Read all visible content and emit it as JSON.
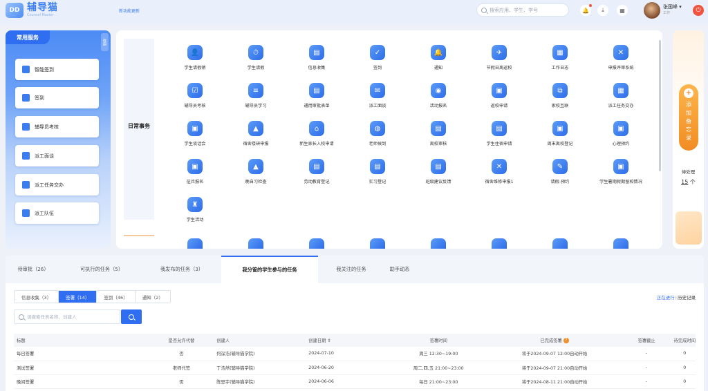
{
  "header": {
    "logo_mark": "DD",
    "app_title": "辅导猫",
    "app_subtitle": "Counsel Master",
    "version_link": "新功能更新",
    "search_placeholder": "搜索应用、学生、学号",
    "user_name": "张国峰",
    "user_role": "工作"
  },
  "quick_panel": {
    "title": "常用服务",
    "collapse": "收起",
    "items": [
      {
        "label": "智能签到",
        "icon": "smart-sign-icon"
      },
      {
        "label": "签到",
        "icon": "checkin-icon"
      },
      {
        "label": "辅导员考核",
        "icon": "assessment-icon"
      },
      {
        "label": "派工面谈",
        "icon": "interview-icon"
      },
      {
        "label": "派工任务交办",
        "icon": "task-assign-icon"
      },
      {
        "label": "派工队伍",
        "icon": "team-icon"
      }
    ]
  },
  "services": {
    "category": "日常事务",
    "items": [
      {
        "label": "学生请假销",
        "icon": "leave-icon",
        "glyph": "👤"
      },
      {
        "label": "学生请假",
        "icon": "clock-icon",
        "glyph": "⏱"
      },
      {
        "label": "信息收集",
        "icon": "collect-icon",
        "glyph": "▤"
      },
      {
        "label": "签到",
        "icon": "checkin-icon",
        "glyph": "✓"
      },
      {
        "label": "通知",
        "icon": "bell-icon",
        "glyph": "🔔"
      },
      {
        "label": "节假日离返校",
        "icon": "travel-icon",
        "glyph": "✈"
      },
      {
        "label": "工作日志",
        "icon": "log-icon",
        "glyph": "▦"
      },
      {
        "label": "申报评审系统",
        "icon": "tools-icon",
        "glyph": "✕"
      },
      {
        "label": "辅导员考核",
        "icon": "assess-icon",
        "glyph": "☑"
      },
      {
        "label": "辅导员学习",
        "icon": "study-icon",
        "glyph": "≡"
      },
      {
        "label": "通用审批表单",
        "icon": "form-icon",
        "glyph": "▤"
      },
      {
        "label": "派工面谈",
        "icon": "talk-icon",
        "glyph": "✉"
      },
      {
        "label": "活动报名",
        "icon": "activity-icon",
        "glyph": "◉"
      },
      {
        "label": "返校申请",
        "icon": "return-icon",
        "glyph": "▣"
      },
      {
        "label": "家校互联",
        "icon": "homeschool-icon",
        "glyph": "⧉"
      },
      {
        "label": "派工任务交办",
        "icon": "assign-icon",
        "glyph": "▦"
      },
      {
        "label": "学生谈话会",
        "icon": "meeting-icon",
        "glyph": "▣"
      },
      {
        "label": "宿舍楼研申报",
        "icon": "dorm-icon",
        "glyph": "▲"
      },
      {
        "label": "新生家长入校申请",
        "icon": "parent-icon",
        "glyph": "⌂"
      },
      {
        "label": "老师候到",
        "icon": "teacher-icon",
        "glyph": "◍"
      },
      {
        "label": "离校审核",
        "icon": "leave-school-icon",
        "glyph": "▤"
      },
      {
        "label": "学生住宿申请",
        "icon": "dorm-apply-icon",
        "glyph": "▤"
      },
      {
        "label": "周末离校登记",
        "icon": "weekend-icon",
        "glyph": "▣"
      },
      {
        "label": "心理预约",
        "icon": "psych-icon",
        "glyph": "▣"
      },
      {
        "label": "征兵报名",
        "icon": "enlist-icon",
        "glyph": "▣"
      },
      {
        "label": "晚自习检查",
        "icon": "evening-study-icon",
        "glyph": "▲"
      },
      {
        "label": "劳动教育登记",
        "icon": "labor-icon",
        "glyph": "▤"
      },
      {
        "label": "实习登记",
        "icon": "intern-icon",
        "glyph": "▤"
      },
      {
        "label": "班级建议反馈",
        "icon": "feedback-icon",
        "glyph": "▤"
      },
      {
        "label": "宿舍维修申报1",
        "icon": "repair-icon",
        "glyph": "✕"
      },
      {
        "label": "请假-预约",
        "icon": "reserve-icon",
        "glyph": "✎"
      },
      {
        "label": "学生暑期假期留校情况",
        "icon": "summer-icon",
        "glyph": "▣"
      },
      {
        "label": "学生活动",
        "icon": "student-activity-icon",
        "glyph": "♜"
      }
    ]
  },
  "side_panel": {
    "add_button": "添加备忘录",
    "todo_label": "待处理",
    "todo_count": "15",
    "todo_unit": "个"
  },
  "tabs": [
    {
      "label": "待审批（26）"
    },
    {
      "label": "可执行的任务（5）"
    },
    {
      "label": "我发布的任务（3）"
    },
    {
      "label": "我分管的学生参与的任务",
      "active": true
    },
    {
      "label": "我关注的任务"
    },
    {
      "label": "助手动态"
    }
  ],
  "subtabs": [
    {
      "label": "信息收集（3）"
    },
    {
      "label": "签署（14）",
      "active": true
    },
    {
      "label": "签到（46）"
    },
    {
      "label": "通知（2）"
    }
  ],
  "links": {
    "running": "正在进行",
    "history": "历史记录"
  },
  "task_search_placeholder": "请搜索任务名称、创建人",
  "table": {
    "headers": [
      "标题",
      "是否允许代替",
      "创建人",
      "创建日期 ⇕",
      "签署时间",
      "已完成签署",
      "签署截止",
      "待完成时间"
    ],
    "rows": [
      [
        "每日签署",
        "否",
        "何深浩(辅导猫学院)",
        "2024-07-10",
        "周三 12:30~19:00",
        "将于2024-09-07 12:00自动开始",
        "-",
        "0"
      ],
      [
        "测试签署",
        "老师代签",
        "丁浩然(辅导猫学院)",
        "2024-06-20",
        "周二,四,五 21:00~23:00",
        "将于2024-09-07 21:00自动开始",
        "-",
        "0"
      ],
      [
        "晚间签署",
        "否",
        "陈思宇(辅导猫学院)",
        "2024-06-06",
        "每日 21:00~23:00",
        "将于2024-08-11 21:00自动开始",
        "-",
        "0"
      ]
    ]
  },
  "colors": {
    "primary": "#2f6ef0",
    "accent": "#f28c24",
    "danger": "#f0533e"
  }
}
